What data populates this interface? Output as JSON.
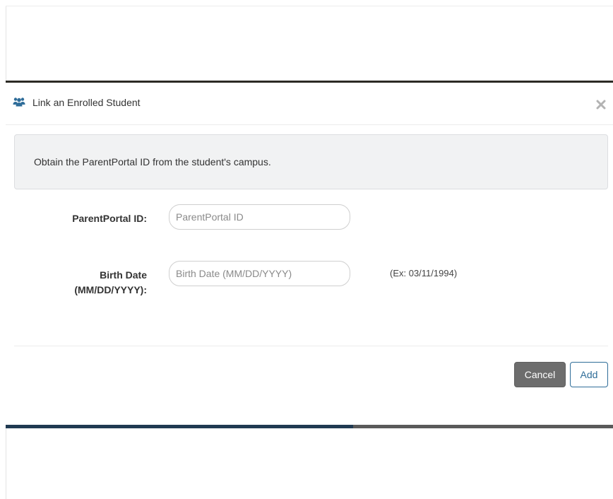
{
  "modal": {
    "title": "Link an Enrolled Student",
    "header_icon": "users-icon",
    "close_icon": "close-icon",
    "notice": "Obtain the ParentPortal ID from the student's campus.",
    "fields": {
      "parentportal_id": {
        "label": "ParentPortal ID:",
        "placeholder": "ParentPortal ID",
        "value": ""
      },
      "birth_date": {
        "label_line1": "Birth Date",
        "label_line2": "(MM/DD/YYYY):",
        "placeholder": "Birth Date (MM/DD/YYYY)",
        "value": "",
        "hint": "(Ex: 03/11/1994)"
      }
    },
    "buttons": {
      "cancel": "Cancel",
      "add": "Add"
    }
  },
  "colors": {
    "modal_top_border": "#2c2a25",
    "header_icon": "#2f6d99",
    "cancel_bg": "#6d6d6d",
    "add_accent": "#2f6d99",
    "notice_bg": "#f1f2f3",
    "bottom_bar_fill": "#203a52",
    "bottom_bar_track": "#5a5a5a"
  }
}
